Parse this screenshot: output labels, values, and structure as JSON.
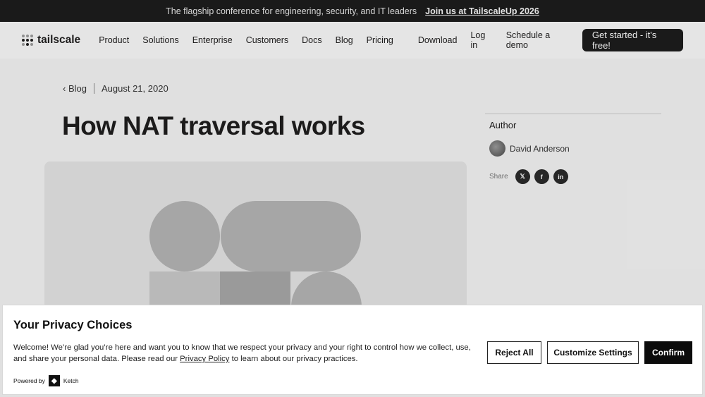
{
  "announcement": {
    "text": "The flagship conference for engineering, security, and IT leaders",
    "link": "Join us at TailscaleUp 2026"
  },
  "nav": {
    "logo": "tailscale",
    "links": [
      "Product",
      "Solutions",
      "Enterprise",
      "Customers",
      "Docs",
      "Blog",
      "Pricing"
    ],
    "right": [
      "Download",
      "Log in",
      "Schedule a demo"
    ],
    "cta": "Get started - it's free!"
  },
  "article": {
    "back_label": "Blog",
    "date": "August 21, 2020",
    "title": "How NAT traversal works"
  },
  "sidebar": {
    "author_heading": "Author",
    "author_name": "David Anderson",
    "share_label": "Share",
    "share_buttons": [
      {
        "icon": "x-icon",
        "glyph": "𝕏"
      },
      {
        "icon": "facebook-icon",
        "glyph": "f"
      },
      {
        "icon": "linkedin-icon",
        "glyph": "in"
      }
    ]
  },
  "privacy": {
    "title": "Your Privacy Choices",
    "message_before": "Welcome! We’re glad you’re here and want you to know that we respect your privacy and your right to control how we collect, use, and share your personal data. Please read our ",
    "policy_link": "Privacy Policy",
    "message_after": " to learn about our privacy practices.",
    "powered_by": "Powered by",
    "brand": "Ketch",
    "reject": "Reject All",
    "customize": "Customize Settings",
    "confirm": "Confirm"
  }
}
